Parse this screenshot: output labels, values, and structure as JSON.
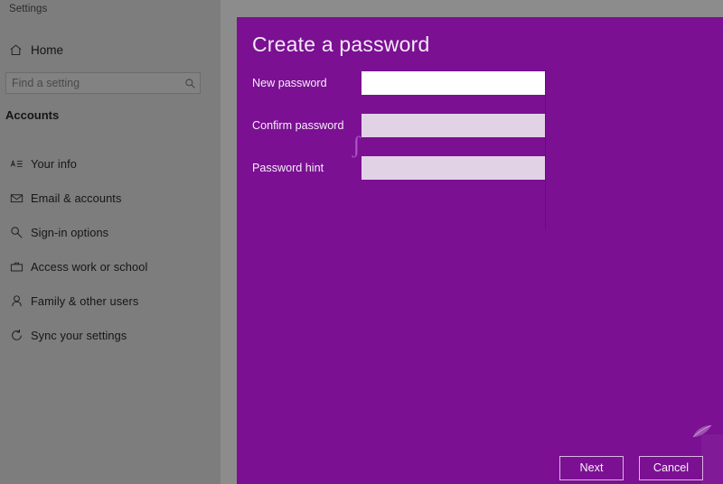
{
  "window": {
    "title": "Settings"
  },
  "sidebar": {
    "home": {
      "label": "Home",
      "icon": "home-icon"
    },
    "search": {
      "placeholder": "Find a setting",
      "value": "",
      "icon": "search-icon"
    },
    "category": "Accounts",
    "items": [
      {
        "label": "Your info",
        "icon": "contact-card-icon"
      },
      {
        "label": "Email & accounts",
        "icon": "envelope-icon"
      },
      {
        "label": "Sign-in options",
        "icon": "key-icon"
      },
      {
        "label": "Access work or school",
        "icon": "briefcase-icon"
      },
      {
        "label": "Family & other users",
        "icon": "person-icon"
      },
      {
        "label": "Sync your settings",
        "icon": "sync-icon"
      }
    ]
  },
  "dialog": {
    "title": "Create a password",
    "fields": [
      {
        "label": "New password",
        "value": "",
        "state": "focused"
      },
      {
        "label": "Confirm password",
        "value": "",
        "state": "inactive"
      },
      {
        "label": "Password hint",
        "value": "",
        "state": "inactive"
      }
    ],
    "buttons": {
      "primary": "Next",
      "secondary": "Cancel"
    },
    "artifacts": {
      "squiggle": "ʃ"
    }
  },
  "colors": {
    "dialog_purple": "#7B1093",
    "sidebar_gray": "#7D7D7D",
    "content_gray": "#8C8C8C",
    "input_inactive": "#E2D2E6",
    "input_focused": "#FFFFFF",
    "button_border": "#D9B6E3"
  }
}
